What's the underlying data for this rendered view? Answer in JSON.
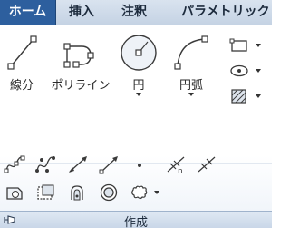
{
  "tabs": [
    {
      "label": "ホーム",
      "active": true
    },
    {
      "label": "挿入",
      "active": false
    },
    {
      "label": "注釈",
      "active": false
    },
    {
      "label": "パラメトリック",
      "active": false
    }
  ],
  "panel": {
    "title": "作成",
    "big_tools": [
      {
        "label": "線分",
        "icon": "line-icon"
      },
      {
        "label": "ポリライン",
        "icon": "polyline-icon"
      },
      {
        "label": "円",
        "icon": "circle-icon",
        "dropdown": true
      },
      {
        "label": "円弧",
        "icon": "arc-icon",
        "dropdown": true
      }
    ],
    "side_tools": [
      "rectangle-icon",
      "ellipse-icon",
      "hatch-icon"
    ],
    "row2_tools": [
      "spline-fit-icon",
      "spline-cv-icon",
      "construction-line-icon",
      "ray-icon",
      "point-icon",
      "divide-icon",
      "measure-icon"
    ],
    "row3_tools": [
      "region-icon",
      "wipeout-icon",
      "3d-polyline-icon",
      "donut-icon",
      "revision-cloud-icon"
    ]
  },
  "colors": {
    "tab_active": "#2d5f9e",
    "icon_stroke": "#3a3a3a",
    "footer": "#c9d7e8"
  }
}
